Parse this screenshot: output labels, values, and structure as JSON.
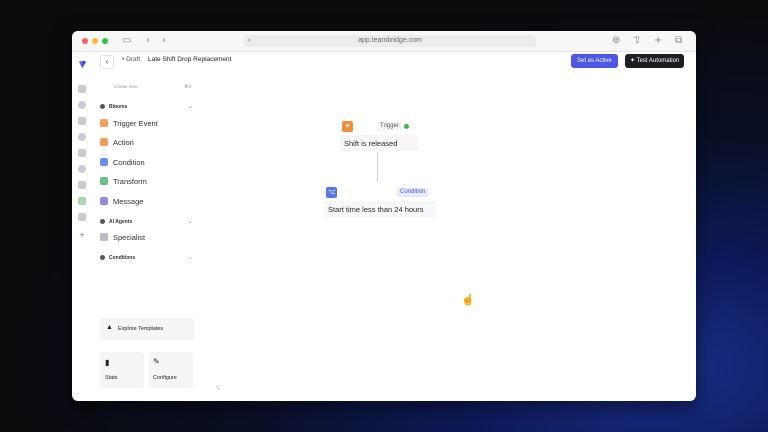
{
  "browser": {
    "url": "app.teambridge.com",
    "colors": {
      "close": "#ff5f57",
      "minimize": "#febc2e",
      "zoom": "#28c840"
    }
  },
  "header": {
    "back_icon": "‹",
    "draft_label": "• Draft",
    "title": "Late Shift Drop Replacement",
    "set_active_label": "Set as Active",
    "test_label": "Test Automation",
    "test_icon": "✦",
    "accent_color": "#4c57e8"
  },
  "sidebar": {
    "search_placeholder": "Create new...",
    "search_shortcut": "⌘K",
    "blooms": {
      "title": "Blooms",
      "items": [
        {
          "label": "Trigger Event",
          "icon": "bolt-icon",
          "color": "#f5a35a"
        },
        {
          "label": "Action",
          "icon": "action-icon",
          "color": "#f09a5a"
        },
        {
          "label": "Condition",
          "icon": "condition-icon",
          "color": "#6a8cf0"
        },
        {
          "label": "Transform",
          "icon": "transform-icon",
          "color": "#6dbf8a"
        },
        {
          "label": "Message",
          "icon": "message-icon",
          "color": "#8f8ae8"
        }
      ]
    },
    "ai_agents": {
      "title": "AI Agents",
      "items": [
        {
          "label": "Specialist",
          "icon": "person-icon"
        }
      ]
    },
    "conditions": {
      "title": "Conditions"
    },
    "explore_label": "Explore Templates",
    "stats_label": "Stats",
    "configure_label": "Configure"
  },
  "canvas": {
    "trigger": {
      "badge": "Trigger",
      "label": "Shift is released",
      "status_color": "#3bb54a"
    },
    "condition": {
      "badge": "Condition",
      "label": "Start time less than 24 hours"
    }
  }
}
